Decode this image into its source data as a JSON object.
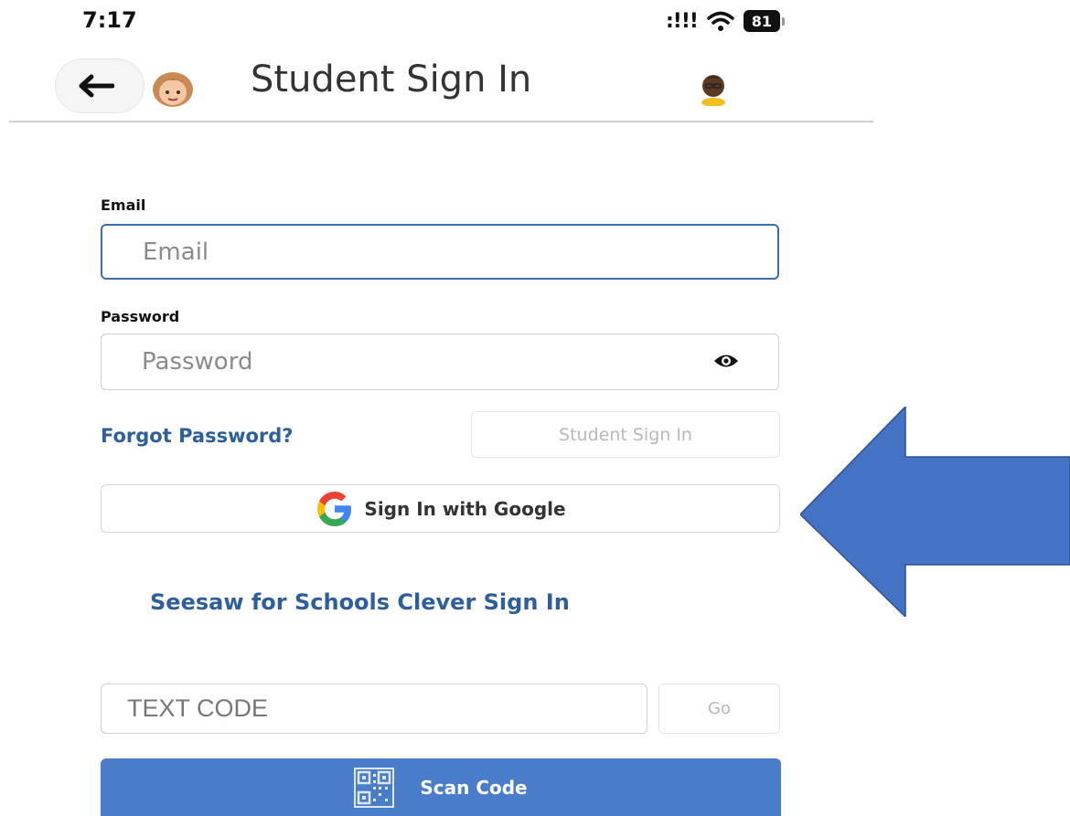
{
  "status_bar": {
    "time": "7:17",
    "signal": ":!!!",
    "battery": "81"
  },
  "header": {
    "title": "Student Sign In"
  },
  "form": {
    "email_label": "Email",
    "email_placeholder": "Email",
    "password_label": "Password",
    "password_placeholder": "Password",
    "forgot_password": "Forgot Password?",
    "student_sign_in": "Student Sign In",
    "google_sign_in": "Sign In with Google",
    "clever_sign_in": "Seesaw for Schools Clever Sign In",
    "code_placeholder": "TEXT CODE",
    "go": "Go",
    "scan_code": "Scan Code"
  },
  "colors": {
    "accent_blue": "#2f5f9a",
    "scan_button_bg": "#4a7dc9",
    "arrow_fill": "#4472c4"
  },
  "icons": [
    "back-arrow-icon",
    "girl-avatar-icon",
    "boy-avatar-icon",
    "eye-icon",
    "google-g-icon",
    "qr-code-icon",
    "wifi-icon",
    "battery-icon"
  ]
}
